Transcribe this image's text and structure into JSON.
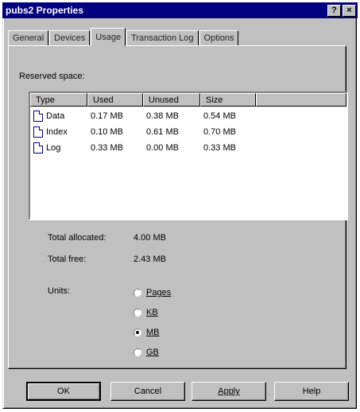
{
  "window": {
    "title": "pubs2 Properties",
    "help_glyph": "?",
    "close_glyph": "×"
  },
  "tabs": [
    {
      "label": "General"
    },
    {
      "label": "Devices"
    },
    {
      "label": "Usage",
      "active": true
    },
    {
      "label": "Transaction Log"
    },
    {
      "label": "Options"
    }
  ],
  "reserved_label": "Reserved space:",
  "table": {
    "columns": [
      "Type",
      "Used",
      "Unused",
      "Size"
    ],
    "rows": [
      {
        "type": "Data",
        "used": "0.17 MB",
        "unused": "0.38 MB",
        "size": "0.54 MB",
        "icon": "document-icon"
      },
      {
        "type": "Index",
        "used": "0.10 MB",
        "unused": "0.61 MB",
        "size": "0.70 MB",
        "icon": "document-icon"
      },
      {
        "type": "Log",
        "used": "0.33 MB",
        "unused": "0.00 MB",
        "size": "0.33 MB",
        "icon": "document-icon"
      }
    ]
  },
  "totals": {
    "allocated_label": "Total allocated:",
    "allocated_value": "4.00 MB",
    "free_label": "Total free:",
    "free_value": "2.43 MB"
  },
  "units": {
    "label": "Units:",
    "options": [
      {
        "label": "Pages",
        "selected": false
      },
      {
        "label": "KB",
        "selected": false
      },
      {
        "label": "MB",
        "selected": true
      },
      {
        "label": "GB",
        "selected": false
      }
    ]
  },
  "buttons": {
    "ok": "OK",
    "cancel": "Cancel",
    "apply": "Apply",
    "help": "Help"
  }
}
